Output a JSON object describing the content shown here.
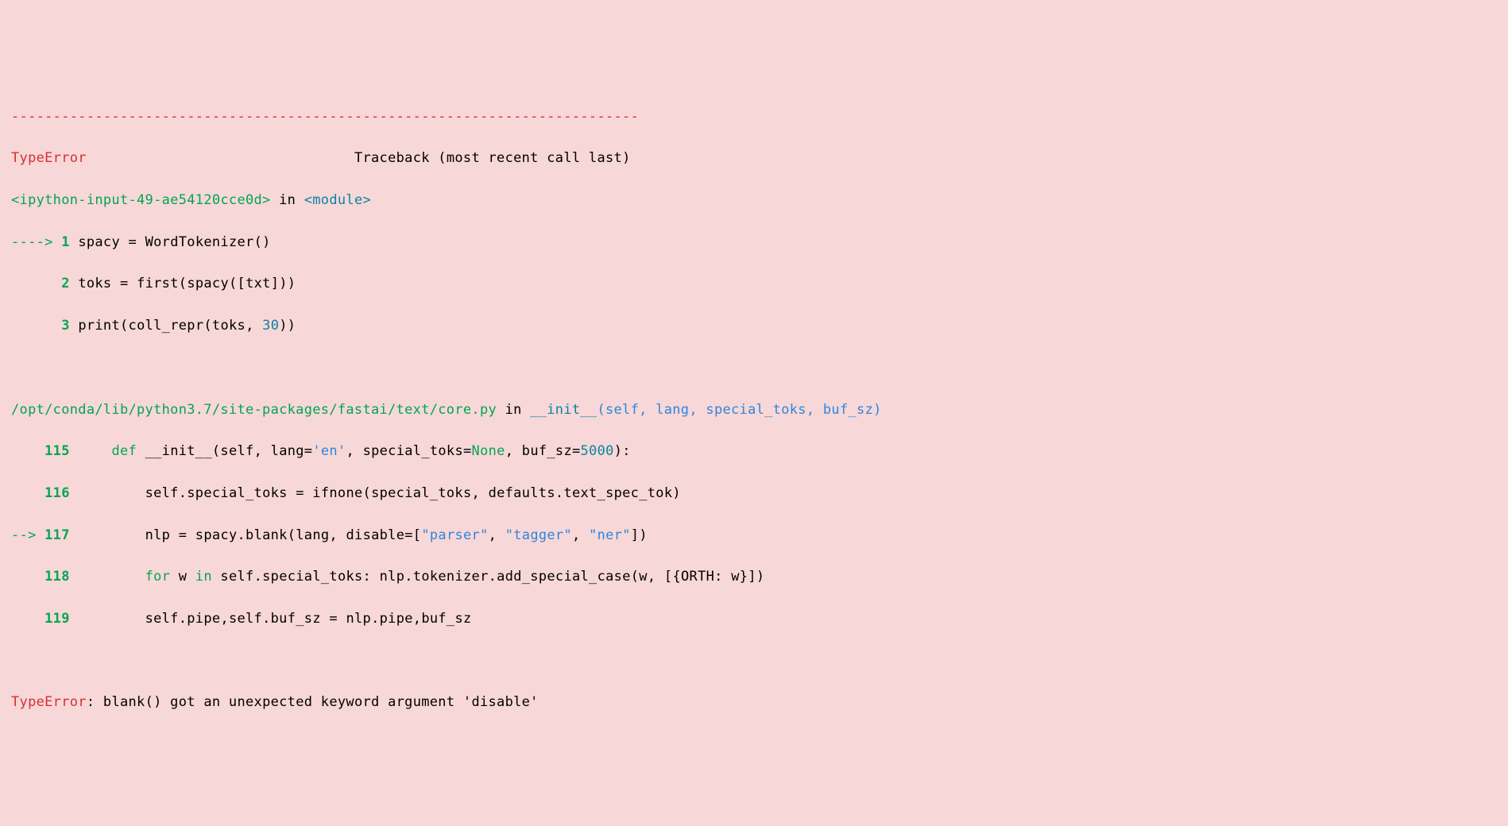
{
  "traceback": {
    "separator": "---------------------------------------------------------------------------",
    "error_type": "TypeError",
    "header_spacer": "                                ",
    "header_text": "Traceback (most recent call last)",
    "frame1": {
      "location": "<ipython-input-49-ae54120cce0d>",
      "in_text": " in ",
      "module": "<module>",
      "line1": {
        "arrow": "----> ",
        "lineno": "1",
        "pad": " ",
        "assign_left": "spacy ",
        "eq": "=",
        "assign_right": " WordTokenizer",
        "lp": "(",
        "rp": ")"
      },
      "line2": {
        "indent": "      ",
        "lineno": "2",
        "pad": " ",
        "assign_left": "toks ",
        "eq": "=",
        "func": " first",
        "lp1": "(",
        "call": "spacy",
        "lp2": "(",
        "lb": "[",
        "arg": "txt",
        "rb": "]",
        "rp2": ")",
        "rp1": ")"
      },
      "line3": {
        "indent": "      ",
        "lineno": "3",
        "pad": " ",
        "func": "print",
        "lp": "(",
        "call": "coll_repr",
        "lp2": "(",
        "arg1": "toks",
        "comma": ",",
        "space": " ",
        "arg2": "30",
        "rp2": ")",
        "rp": ")"
      }
    },
    "frame2": {
      "location": "/opt/conda/lib/python3.7/site-packages/fastai/text/core.py",
      "in_text": " in ",
      "func": "__init__",
      "args_open": "(self, lang, special_toks, buf_sz)",
      "line115": {
        "indent": "    ",
        "lineno": "115",
        "pad": "     ",
        "kw_def": "def",
        "space1": " ",
        "name": "__init__",
        "lp": "(",
        "p_self": "self",
        "c1": ",",
        "sp1": " ",
        "p_lang": "lang",
        "eq1": "=",
        "v_lang": "'en'",
        "c2": ",",
        "sp2": " ",
        "p_st": "special_toks",
        "eq2": "=",
        "v_none": "None",
        "c3": ",",
        "sp3": " ",
        "p_buf": "buf_sz",
        "eq3": "=",
        "v_5000": "5000",
        "rp": ")",
        "colon": ":"
      },
      "line116": {
        "indent": "    ",
        "lineno": "116",
        "pad": "         ",
        "lhs": "self",
        "dot": ".",
        "attr": "special_toks ",
        "eq": "=",
        "rest1": " ifnone",
        "lp": "(",
        "arg1": "special_toks",
        "c1": ",",
        "sp1": " ",
        "arg2a": "defaults",
        "dot2": ".",
        "arg2b": "text_spec_tok",
        "rp": ")"
      },
      "line117": {
        "arrow": "--> ",
        "lineno": "117",
        "pad": "         ",
        "lhs": "nlp ",
        "eq": "=",
        "obj": " spacy",
        "dot": ".",
        "method": "blank",
        "lp": "(",
        "arg1": "lang",
        "c1": ",",
        "sp1": " ",
        "kw": "disable",
        "eq2": "=",
        "lb": "[",
        "s1": "\"parser\"",
        "c2": ",",
        "sp2": " ",
        "s2": "\"tagger\"",
        "c3": ",",
        "sp3": " ",
        "s3": "\"ner\"",
        "rb": "]",
        "rp": ")"
      },
      "line118": {
        "indent": "    ",
        "lineno": "118",
        "pad": "         ",
        "kw_for": "for",
        "sp1": " ",
        "var": "w ",
        "kw_in": "in",
        "obj": " self",
        "dot": ".",
        "attr": "special_toks",
        "colon": ":",
        "sp2": " ",
        "nlp": "nlp",
        "dot2": ".",
        "tok": "tokenizer",
        "dot3": ".",
        "method": "add_special_case",
        "lp": "(",
        "arg1": "w",
        "c1": ",",
        "sp3": " ",
        "lb": "[",
        "lbr": "{",
        "orth": "ORTH",
        "colon2": ":",
        "sp4": " ",
        "w": "w",
        "rbr": "}",
        "rb": "]",
        "rp": ")"
      },
      "line119": {
        "indent": "    ",
        "lineno": "119",
        "pad": "         ",
        "lhs1": "self",
        "d1": ".",
        "a1": "pipe",
        "c1": ",",
        "lhs2": "self",
        "d2": ".",
        "a2": "buf_sz ",
        "eq": "=",
        "rhs1": " nlp",
        "d3": ".",
        "a3": "pipe",
        "c2": ",",
        "rhs2": "buf_sz"
      }
    },
    "final": {
      "error_type": "TypeError",
      "colon": ": ",
      "message": "blank() got an unexpected keyword argument 'disable'"
    }
  }
}
